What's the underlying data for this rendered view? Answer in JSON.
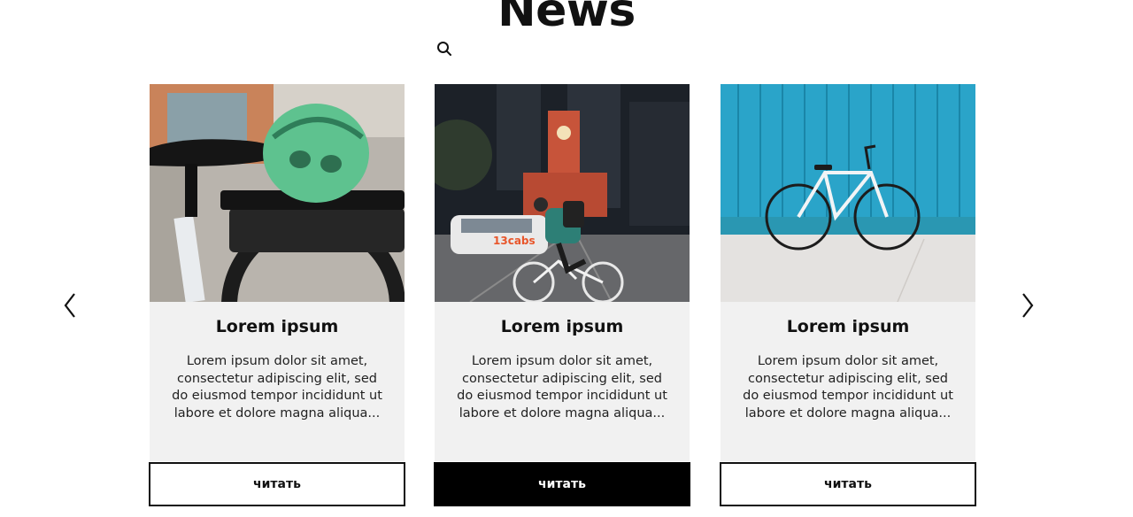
{
  "page": {
    "title": "News",
    "search_icon": "search-icon",
    "prev_icon": "chevron-left-icon",
    "next_icon": "chevron-right-icon"
  },
  "cards": [
    {
      "title": "Lorem ipsum",
      "text": "Lorem ipsum dolor sit amet, consectetur adipiscing elit, sed do eiusmod tempor incididunt ut labore et dolore magna aliqua...",
      "button": "читать",
      "image": "bike-saddle-helmet",
      "button_active": false
    },
    {
      "title": "Lorem ipsum",
      "text": "Lorem ipsum dolor sit amet, consectetur adipiscing elit, sed do eiusmod tempor incididunt ut labore et dolore magna aliqua...",
      "button": "читать",
      "image": "city-cyclist-night",
      "taxi_text": "13cabs",
      "button_active": true
    },
    {
      "title": "Lorem ipsum",
      "text": "Lorem ipsum dolor sit amet, consectetur adipiscing elit, sed do eiusmod tempor incididunt ut labore et dolore magna aliqua...",
      "button": "читать",
      "image": "bike-blue-wall",
      "button_active": false
    }
  ],
  "colors": {
    "card_body": "#f1f1f1",
    "button_active_bg": "#000000",
    "button_border": "#111111"
  }
}
